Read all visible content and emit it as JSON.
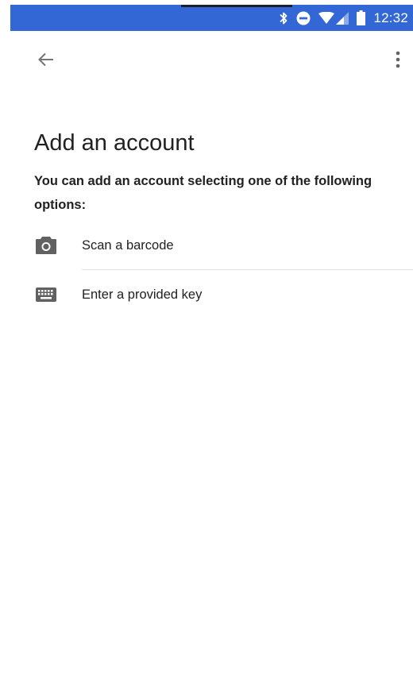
{
  "status_bar": {
    "time": "12:32",
    "icons": [
      "bluetooth-icon",
      "do-not-disturb-icon",
      "wifi-icon",
      "signal-icon",
      "battery-icon"
    ],
    "background_color": "#3367d6"
  },
  "toolbar": {
    "back_icon": "arrow-back-icon",
    "more_icon": "more-vert-icon"
  },
  "page": {
    "title": "Add an account",
    "description": "You can add an account selecting one of the following options:"
  },
  "options": [
    {
      "label": "Scan a barcode",
      "icon": "camera-icon"
    },
    {
      "label": "Enter a provided key",
      "icon": "keyboard-icon"
    }
  ]
}
